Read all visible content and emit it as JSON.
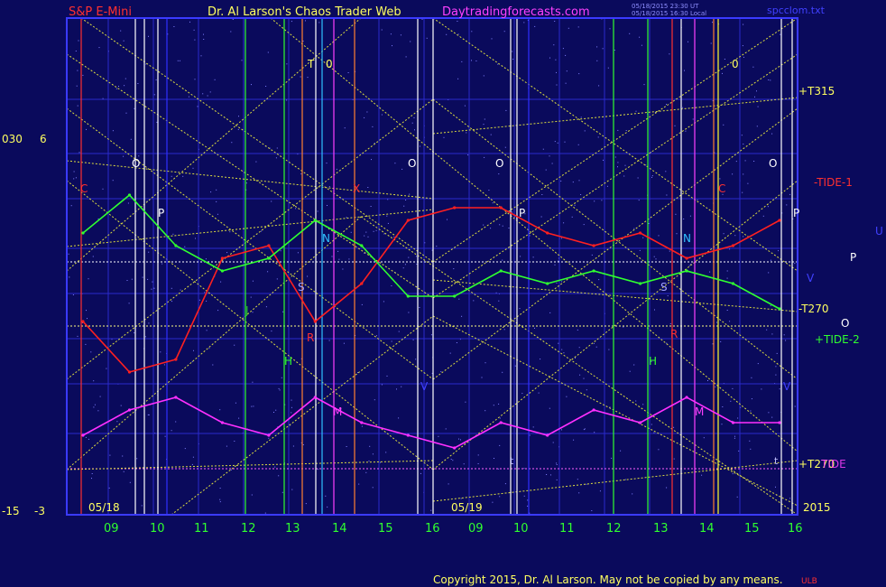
{
  "header": {
    "symbol": "S&P E-Mini",
    "title": "Dr. Al Larson's Chaos Trader Web",
    "site": "Daytradingforecasts.com",
    "stamp_line1": "05/18/2015 23:30 UT",
    "stamp_line2": "05/18/2015 16:30 Local",
    "file": "spcclom.txt"
  },
  "footer": {
    "copyright": "Copyright 2015, Dr. Al Larson. May not be copied by any means.",
    "mark": "ULB"
  },
  "left_axis": {
    "top_a": "030",
    "top_b": "6",
    "bottom_a": "-15",
    "bottom_b": "-3"
  },
  "date_labels": {
    "d1": "05/18",
    "d2": "05/19",
    "year": "2015"
  },
  "x_ticks": [
    "09",
    "10",
    "11",
    "12",
    "13",
    "14",
    "15",
    "16",
    "09",
    "10",
    "11",
    "12",
    "13",
    "14",
    "15",
    "16"
  ],
  "right_labels": {
    "t315": "+T315",
    "tide1": "-TIDE-1",
    "t270a": "-T270",
    "tide2": "+TIDE-2",
    "t270b": "+T270",
    "tidec": "TIDE",
    "u": "U",
    "p": "P",
    "o": "O",
    "v": "V"
  },
  "markers": {
    "T": "T",
    "Zero": "0",
    "O": "O",
    "P": "P",
    "C": "C",
    "N": "N",
    "S": "S",
    "J": "J",
    "R": "R",
    "H": "H",
    "M": "M",
    "V": "V",
    "X": "X",
    "t": "t"
  },
  "colors": {
    "background": "#0a0a5c",
    "grid": "#3a3aff",
    "tide1": "#ff2020",
    "tide2": "#30ff30",
    "tidec": "#ff30ff",
    "trend": "#ffff40"
  },
  "chart_data": {
    "type": "line",
    "title": "S&P E-Mini",
    "x": [
      "09",
      "10",
      "11",
      "12",
      "13",
      "14",
      "15",
      "16",
      "09",
      "10",
      "11",
      "12",
      "13",
      "14",
      "15",
      "16"
    ],
    "series": [
      {
        "name": "-TIDE-1",
        "values": [
          -4,
          -8,
          -7,
          1,
          2,
          -4,
          -1,
          4,
          5,
          5,
          3,
          2,
          3,
          1,
          2,
          4
        ]
      },
      {
        "name": "+TIDE-2",
        "values": [
          3,
          6,
          2,
          0,
          1,
          4,
          2,
          -2,
          -2,
          0,
          -1,
          0,
          -1,
          0,
          -1,
          -3
        ]
      },
      {
        "name": "+TIDE",
        "values": [
          -13,
          -11,
          -10,
          -12,
          -13,
          -10,
          -12,
          -13,
          -14,
          -12,
          -13,
          -11,
          -12,
          -10,
          -12,
          -12
        ]
      }
    ],
    "y_labels": [
      "030",
      "6",
      "-15",
      "-3"
    ],
    "grid": true
  }
}
